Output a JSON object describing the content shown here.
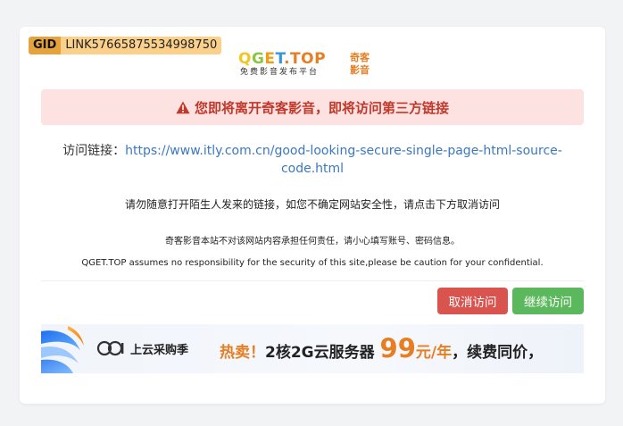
{
  "gid": {
    "badge": "GID",
    "value": "LINK57665875534998750"
  },
  "logo": {
    "q": "Q",
    "g": "G",
    "e": "E",
    "t": "T",
    "dot": ".",
    "top": "TOP",
    "tagline": "免费影音发布平台",
    "cn_top": "奇客",
    "cn_bottom": "影音"
  },
  "alert": {
    "text": "您即将离开奇客影音，即将访问第三方链接"
  },
  "link": {
    "label": "访问链接：",
    "url": "https://www.itly.com.cn/good-looking-secure-single-page-html-source-code.html"
  },
  "notices": {
    "line1": "请勿随意打开陌生人发来的链接，如您不确定网站安全性，请点击下方取消访问",
    "line2": "奇客影音本站不对该网站内容承担任何责任，请小心填写账号、密码信息。",
    "line3": "QGET.TOP assumes no responsibility for the security of this site,please be caution for your confidential."
  },
  "buttons": {
    "cancel": "取消访问",
    "continue": "继续访问"
  },
  "banner": {
    "brand": "上云采购季",
    "hot": "热卖！",
    "product": "2核2G云服务器",
    "price": "99",
    "unit": "元/年",
    "tail": "，续费同价，"
  },
  "colors": {
    "alert_bg": "#fde2e2",
    "alert_text": "#c0392b",
    "link": "#3a78c2",
    "cancel": "#d9534f",
    "continue": "#5cb85c",
    "gid_badge": "#e6a23c",
    "gid_value": "#fbd08a",
    "promo_orange": "#e67e22"
  }
}
